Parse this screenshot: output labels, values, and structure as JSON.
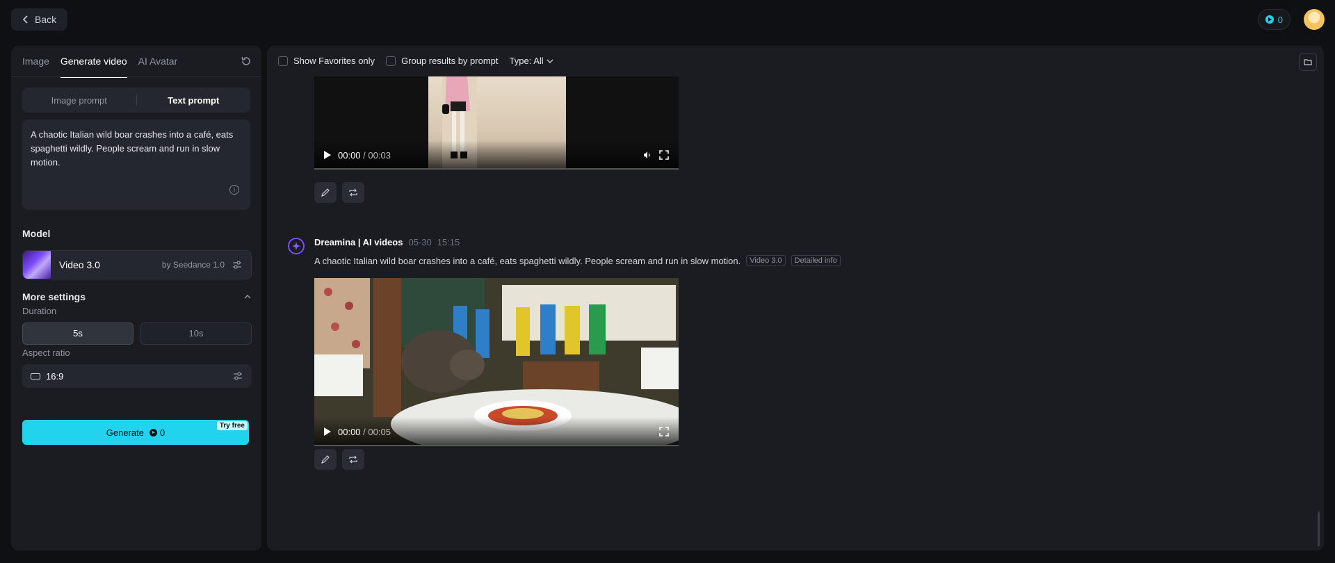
{
  "topbar": {
    "back_label": "Back",
    "credits": "0"
  },
  "sidebar": {
    "tabs": [
      "Image",
      "Generate video",
      "AI Avatar"
    ],
    "prompt_modes": [
      "Image prompt",
      "Text prompt"
    ],
    "prompt_text": "A chaotic Italian wild boar crashes into a café, eats spaghetti wildly. People scream and run in slow motion.",
    "model_title": "Model",
    "model_name": "Video 3.0",
    "model_by": "by Seedance 1.0",
    "more_settings": "More settings",
    "duration_label": "Duration",
    "duration_options": [
      "5s",
      "10s"
    ],
    "aspect_label": "Aspect ratio",
    "aspect_value": "16:9",
    "generate_label": "Generate",
    "generate_cost": "0",
    "try_free": "Try free"
  },
  "main": {
    "filters": {
      "favorites": "Show Favorites only",
      "group": "Group results by prompt",
      "type": "Type: All"
    },
    "video1": {
      "time_current": "00:00",
      "time_total": "/ 00:03"
    },
    "message": {
      "bot_name": "Dreamina | AI videos",
      "date": "05-30",
      "time": "15:15",
      "prompt": "A chaotic Italian wild boar crashes into a café, eats spaghetti wildly. People scream and run in slow motion.",
      "tag_model": "Video 3.0",
      "tag_info": "Detailed info"
    },
    "video2": {
      "time_current": "00:00",
      "time_total": "/ 00:05"
    }
  }
}
